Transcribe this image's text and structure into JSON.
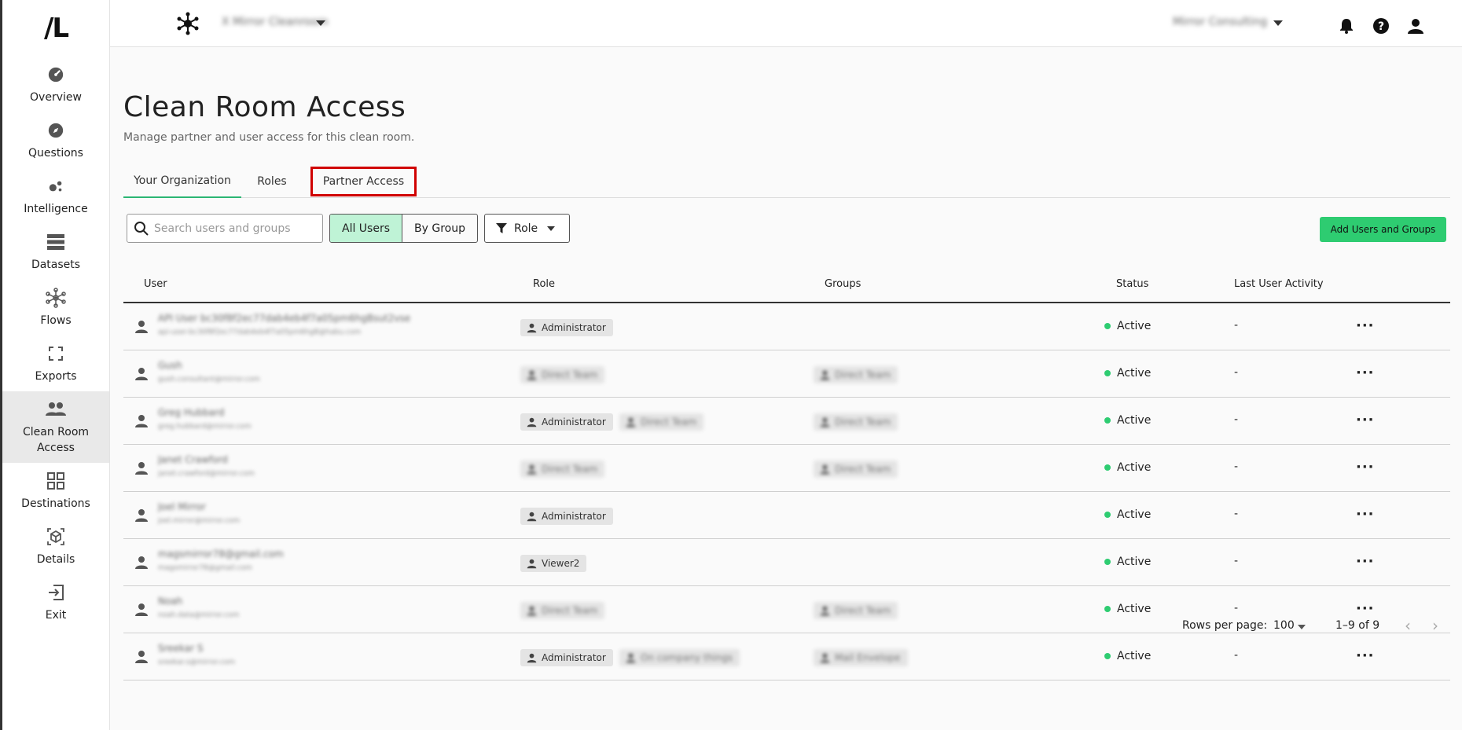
{
  "app": {
    "logo_text": "/L",
    "clean_room_name": "X Mirror Cleanroom",
    "organization_name": "Mirror Consulting"
  },
  "sidebar": {
    "items": [
      {
        "label": "Overview",
        "icon": "gauge-icon"
      },
      {
        "label": "Questions",
        "icon": "compass-icon"
      },
      {
        "label": "Intelligence",
        "icon": "bubbles-icon"
      },
      {
        "label": "Datasets",
        "icon": "stack-icon"
      },
      {
        "label": "Flows",
        "icon": "network-icon"
      },
      {
        "label": "Exports",
        "icon": "frame-icon"
      },
      {
        "label": "Clean Room Access",
        "icon": "people-icon",
        "active": true
      },
      {
        "label": "Destinations",
        "icon": "grid-icon"
      },
      {
        "label": "Details",
        "icon": "cube-icon"
      },
      {
        "label": "Exit",
        "icon": "exit-icon"
      }
    ]
  },
  "page": {
    "title": "Clean Room Access",
    "subtitle": "Manage partner and user access for this clean room."
  },
  "tabs": [
    {
      "label": "Your Organization",
      "active": true
    },
    {
      "label": "Roles",
      "active": false
    },
    {
      "label": "Partner Access",
      "active": false,
      "highlighted": true
    }
  ],
  "toolbar": {
    "search_placeholder": "Search users and groups",
    "all_users_label": "All Users",
    "by_group_label": "By Group",
    "role_filter_label": "Role",
    "add_button_label": "Add Users and Groups"
  },
  "table": {
    "columns": [
      "User",
      "Role",
      "Groups",
      "Status",
      "Last User Activity"
    ],
    "rows": [
      {
        "name": "API User bc30f8f2ec77dab4eb4f7a05pm6hgBsut2vse",
        "email": "api-user-bc30f8f2ec77dab4eb4f7a05pm6hgB@habu.com",
        "roles": [
          "Administrator"
        ],
        "roles_blurred": [],
        "groups": [],
        "status": "Active",
        "activity": "-"
      },
      {
        "name": "Gush",
        "email": "gush.consultant@mirror.com",
        "roles": [],
        "roles_blurred": [
          "Direct Team"
        ],
        "groups": [
          "Direct Team"
        ],
        "status": "Active",
        "activity": "-"
      },
      {
        "name": "Greg Hubbard",
        "email": "greg.hubbard@mirror.com",
        "roles": [
          "Administrator"
        ],
        "roles_blurred": [
          "Direct Team"
        ],
        "groups": [
          "Direct Team"
        ],
        "status": "Active",
        "activity": "-"
      },
      {
        "name": "Janet Crawford",
        "email": "janet.crawford@mirror.com",
        "roles": [],
        "roles_blurred": [
          "Direct Team"
        ],
        "groups": [
          "Direct Team"
        ],
        "status": "Active",
        "activity": "-"
      },
      {
        "name": "Joel Mirror",
        "email": "joel.mirror@mirror.com",
        "roles": [
          "Administrator"
        ],
        "roles_blurred": [],
        "groups": [],
        "status": "Active",
        "activity": "-"
      },
      {
        "name": "magsmirror78@gmail.com",
        "email": "magsmirror78@gmail.com",
        "roles": [
          "Viewer2"
        ],
        "roles_blurred": [],
        "groups": [],
        "status": "Active",
        "activity": "-"
      },
      {
        "name": "Noah",
        "email": "noah.data@mirror.com",
        "roles": [],
        "roles_blurred": [
          "Direct Team"
        ],
        "groups": [
          "Direct Team"
        ],
        "status": "Active",
        "activity": "-"
      },
      {
        "name": "Sreekar S",
        "email": "sreekar.s@mirror.com",
        "roles": [
          "Administrator"
        ],
        "roles_blurred": [
          "On company things"
        ],
        "groups": [
          "Mail Envelope"
        ],
        "status": "Active",
        "activity": "-"
      }
    ]
  },
  "pagination": {
    "rows_per_page_label": "Rows per page:",
    "rows_per_page_value": "100",
    "range_label": "1–9 of 9"
  }
}
